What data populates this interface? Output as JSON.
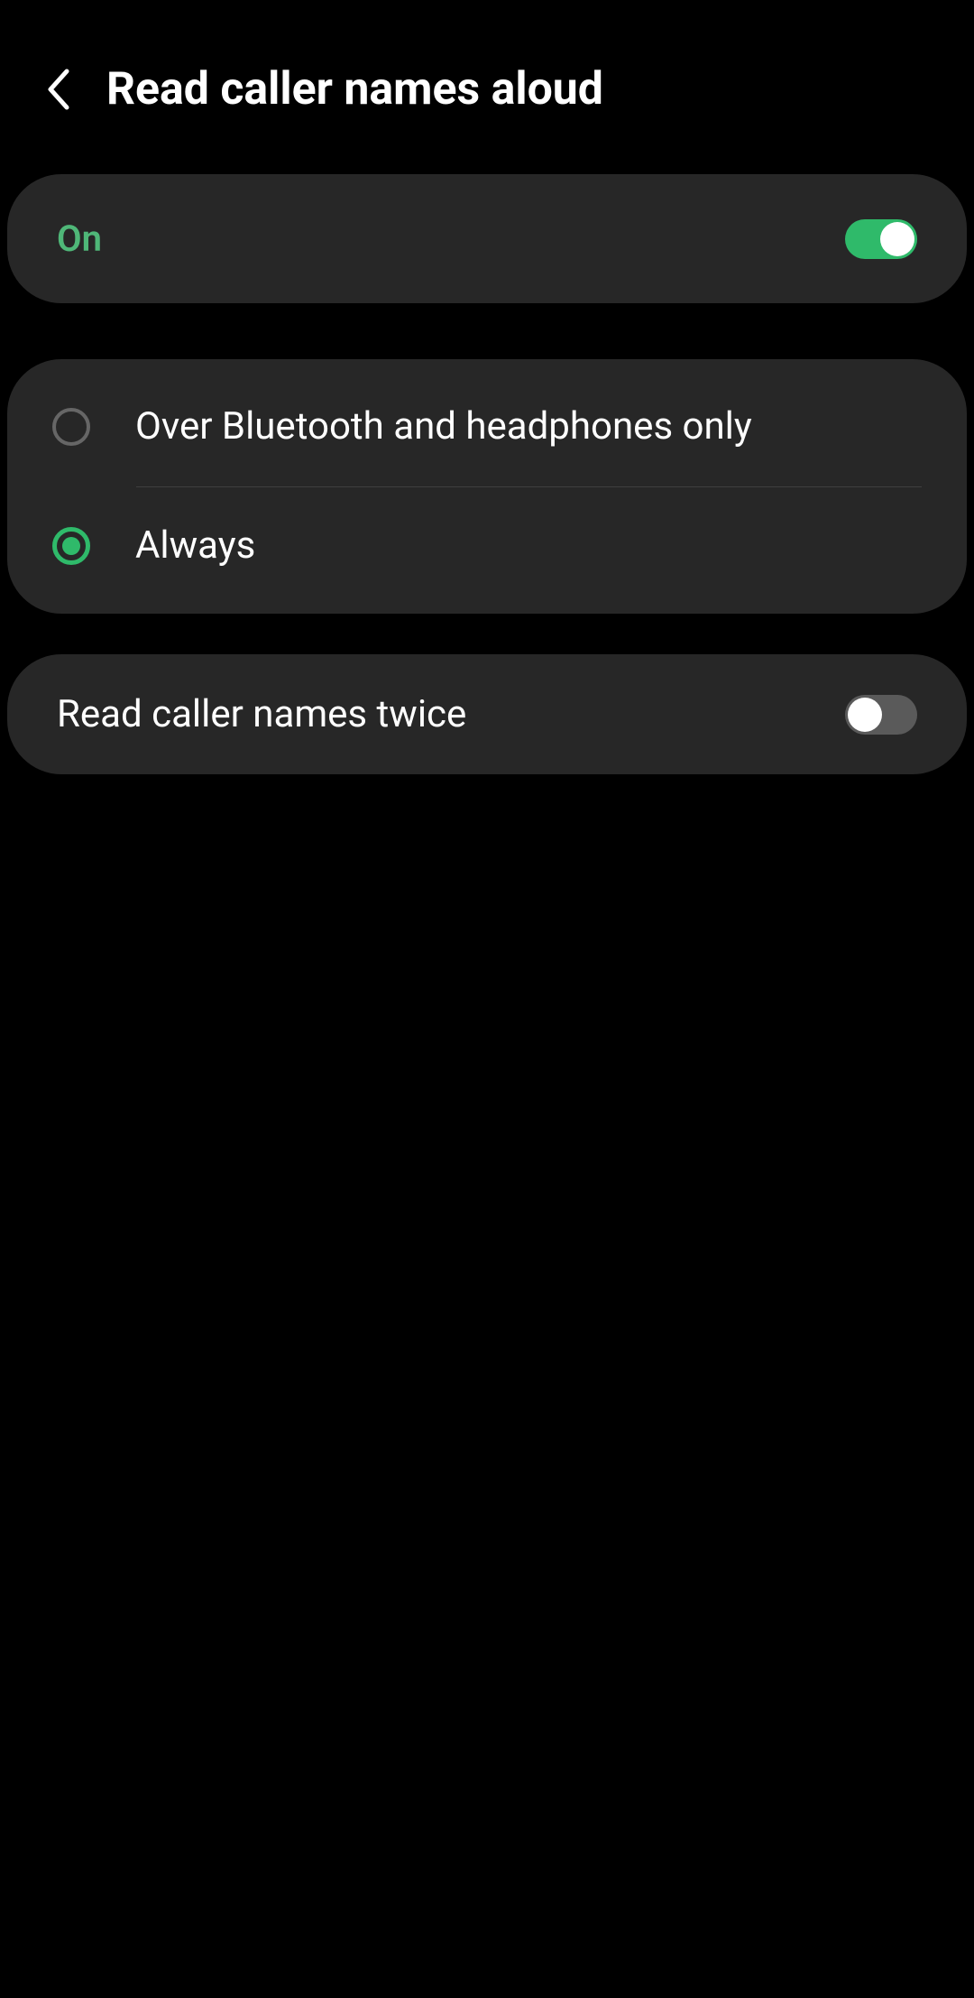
{
  "header": {
    "title": "Read caller names aloud"
  },
  "mainToggle": {
    "label": "On",
    "enabled": true
  },
  "radioOptions": {
    "option1": {
      "label": "Over Bluetooth and headphones only",
      "selected": false
    },
    "option2": {
      "label": "Always",
      "selected": true
    }
  },
  "secondaryToggle": {
    "label": "Read caller names twice",
    "enabled": false
  }
}
